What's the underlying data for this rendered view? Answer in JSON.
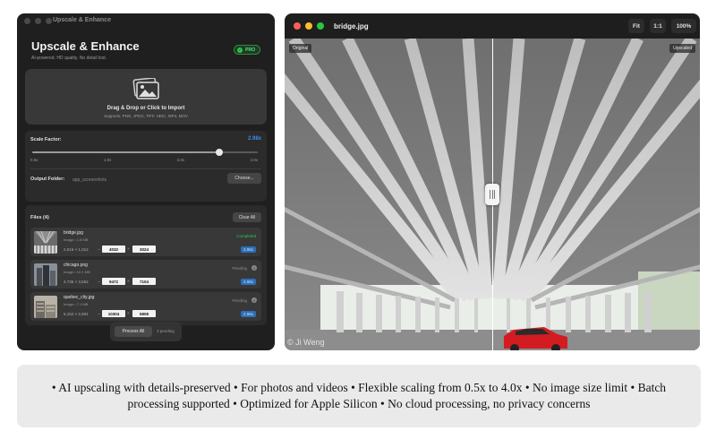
{
  "left_window": {
    "title": "Upscale & Enhance",
    "app_title": "Upscale & Enhance",
    "subtitle": "AI-powered. HD quality. No detail lost.",
    "badge": "PRO",
    "drop_zone": {
      "title": "Drag & Drop or Click to Import",
      "subtitle": "Supports: PNG, JPEG, TIFF, HEIC, MP4, MOV"
    },
    "scale": {
      "label": "Scale Factor:",
      "value_text": "2.98x",
      "value": 2.98,
      "min": 0.5,
      "max": 4.0,
      "ticks": [
        "0.5x",
        "1.0x",
        "2.0x",
        "4.0x"
      ]
    },
    "output": {
      "label": "Output Folder:",
      "value": "app_screenshots",
      "choose_label": "Choose..."
    },
    "files": {
      "title": "Files (4)",
      "clear_label": "Clear All",
      "items": [
        {
          "name": "bridge.jpg",
          "meta": "Image  •  1.8 MB",
          "orig": "2,016 × 1,012",
          "w": "4032",
          "h": "3024",
          "status": "Completed",
          "mult": "2.98x"
        },
        {
          "name": "chicago.png",
          "meta": "Image  •  10.1 MB",
          "orig": "4,736 × 3,552",
          "w": "9472",
          "h": "7104",
          "status": "Pending",
          "mult": "2.98x"
        },
        {
          "name": "quebec_city.jpg",
          "meta": "Image  •  7.1 MB",
          "orig": "5,152 × 2,904",
          "w": "10304",
          "h": "5808",
          "status": "Pending",
          "mult": "2.98x"
        }
      ]
    },
    "process": {
      "label": "Process All",
      "pending": "3 pending"
    }
  },
  "right_window": {
    "title": "bridge.jpg",
    "fit_label": "Fit",
    "one_to_one_label": "1:1",
    "zoom_label": "100%",
    "original_tag": "Original",
    "upscaled_tag": "Upscaled",
    "credit": "© Ji Weng"
  },
  "features_text": "• AI upscaling with details-preserved   • For photos and videos   • Flexible scaling from 0.5x to 4.0x   • No image size limit   • Batch processing supported   • Optimized for Apple Silicon   • No cloud processing, no privacy concerns",
  "colors": {
    "accent_blue": "#3c8ce6",
    "completed_green": "#31c35a",
    "pro_green": "#2fc552"
  }
}
